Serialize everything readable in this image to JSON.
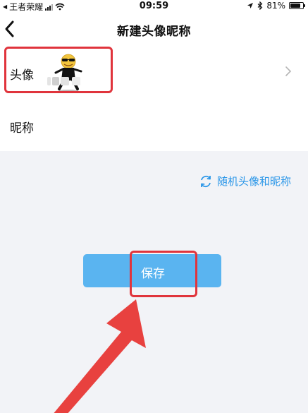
{
  "status_bar": {
    "carrier": "王者荣耀",
    "time": "09:59",
    "battery": "81%",
    "battery_level": 0.81
  },
  "nav": {
    "title": "新建头像昵称"
  },
  "form": {
    "avatar_label": "头像",
    "nickname_label": "昵称"
  },
  "random_button": {
    "label": "随机头像和昵称",
    "icon": "refresh-icon"
  },
  "save_button": {
    "label": "保存"
  },
  "colors": {
    "accent": "#2a96e8",
    "button": "#5ab4f0",
    "annotation": "#e0343c"
  }
}
